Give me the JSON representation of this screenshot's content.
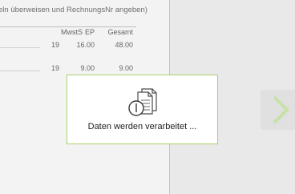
{
  "document": {
    "instruction_text": "eln überweisen und RechnungsNr angeben)",
    "table": {
      "headers": {
        "mwst": "MwstS",
        "ep": "EP",
        "gesamt": "Gesamt"
      },
      "rows": [
        {
          "mwst": "19",
          "ep": "16.00",
          "gesamt": "48.00"
        },
        {
          "mwst": "19",
          "ep": "9.00",
          "gesamt": "9.00"
        }
      ]
    }
  },
  "navigation": {
    "next_icon": "chevron-right-icon",
    "accent_color": "#a9d26a"
  },
  "loading_dialog": {
    "icon": "documents-clock-icon",
    "text": "Daten werden verarbeitet ...",
    "border_color": "#a9d26a"
  }
}
